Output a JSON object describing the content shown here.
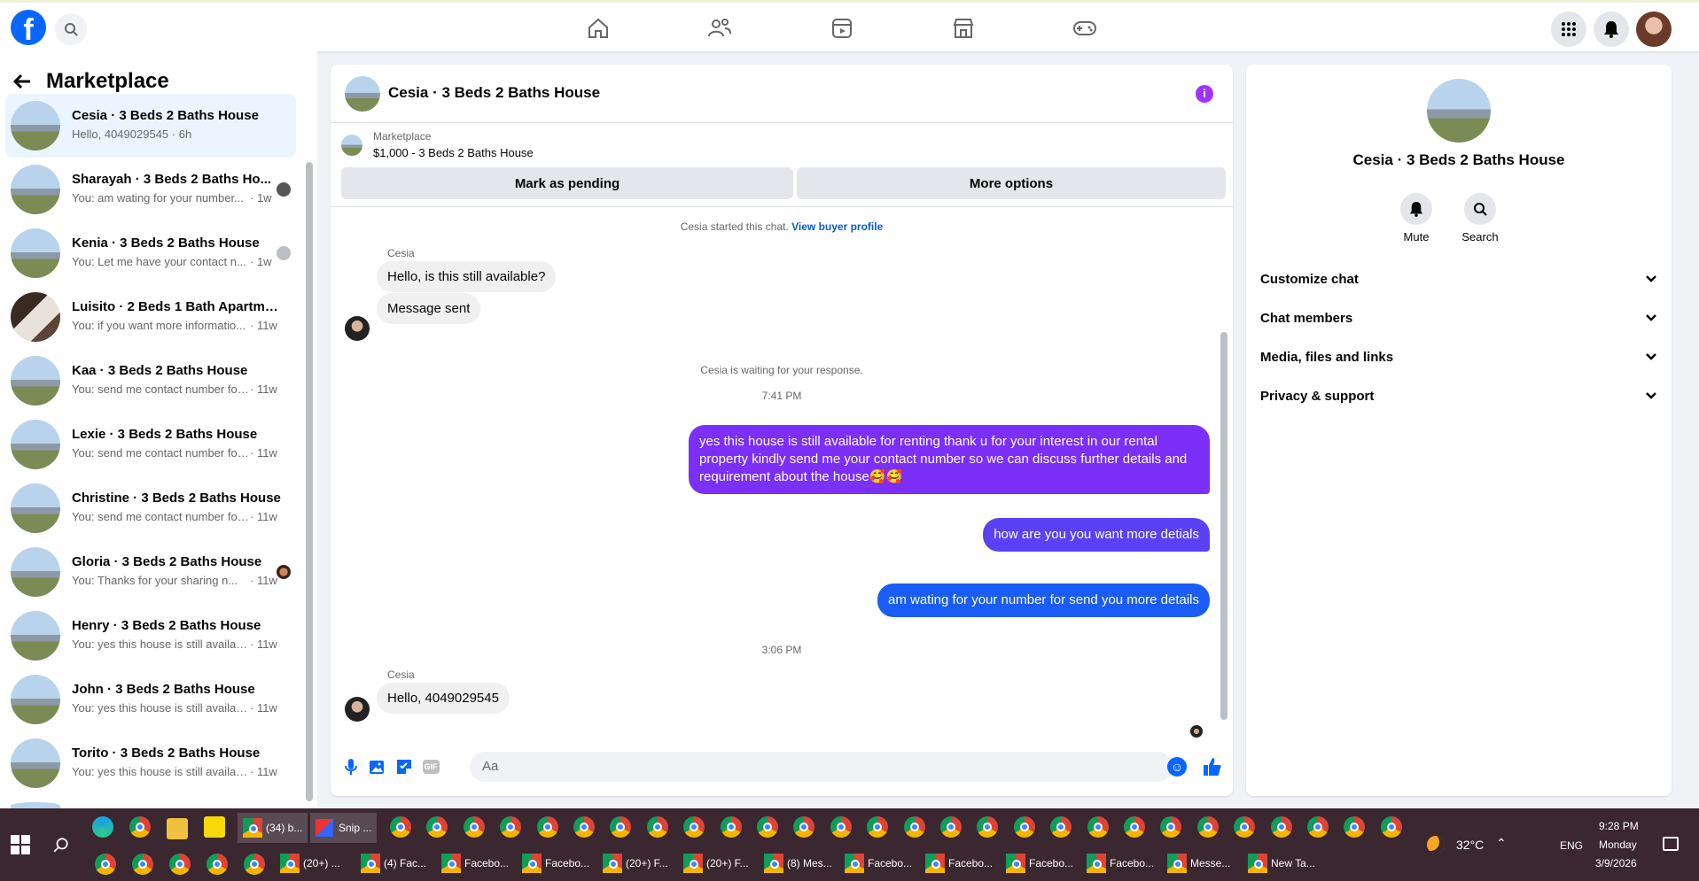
{
  "nav": {
    "logo_letter": "f"
  },
  "sidebar": {
    "title": "Marketplace",
    "conversations": [
      {
        "name": "Cesia · 3 Beds 2 Baths House",
        "preview": "Hello, 4049029545",
        "time": " · 6h",
        "active": true
      },
      {
        "name": "Sharayah · 3 Beds 2 Baths Ho...",
        "preview": "You: am wating for your number...",
        "time": " · 1w"
      },
      {
        "name": "Kenia · 3 Beds 2 Baths House",
        "preview": "You: Let me have your contact n...",
        "time": " · 1w"
      },
      {
        "name": "Luisito · 2 Beds 1 Bath Apartmen...",
        "preview": "You: if you want more informatio...",
        "time": " · 11w"
      },
      {
        "name": "Kaa · 3 Beds 2 Baths House",
        "preview": "You: send me contact number for ...",
        "time": " · 11w"
      },
      {
        "name": "Lexie · 3 Beds 2 Baths House",
        "preview": "You: send me contact number for ...",
        "time": " · 11w"
      },
      {
        "name": "Christine · 3 Beds 2 Baths House",
        "preview": "You: send me contact number for ...",
        "time": " · 11w"
      },
      {
        "name": "Gloria · 3 Beds 2 Baths House",
        "preview": "You: Thanks for your sharing n...",
        "time": " · 11w"
      },
      {
        "name": "Henry · 3 Beds 2 Baths House",
        "preview": "You: yes this house is still availabl...",
        "time": " · 11w"
      },
      {
        "name": "John · 3 Beds 2 Baths House",
        "preview": "You: yes this house is still availabl...",
        "time": " · 11w"
      },
      {
        "name": "Torito · 3 Beds 2 Baths House",
        "preview": "You: yes this house is still availabl...",
        "time": " · 11w"
      }
    ]
  },
  "chat": {
    "title": "Cesia · 3 Beds 2 Baths House",
    "info_glyph": "i",
    "marketplace_label": "Marketplace",
    "listing": "$1,000 - 3 Beds 2 Baths House",
    "mark_pending": "Mark as pending",
    "more_options": "More options",
    "started_text": "Cesia started this chat.",
    "view_profile": "View buyer profile",
    "sender_name": "Cesia",
    "msg_in_1": "Hello, is this still available?",
    "msg_in_2": "Message sent",
    "waiting_text": "Cesia is waiting for your response.",
    "time_1": "7:41 PM",
    "msg_out_1": "yes this house is still  available for renting thank u for your interest  in our rental property kindly send me your contact number so we can discuss further details and requirement about the house🥰🥰",
    "msg_out_2": "how are you  you want more detials",
    "msg_out_3": "am wating for your  number for send you more details",
    "time_2": "3:06 PM",
    "msg_in_3": "Hello, 4049029545",
    "composer_placeholder": "Aa",
    "gif_label": "GIF",
    "colors": {
      "out_purple": "#7b2ff7",
      "out_blue": "#1b5cf5"
    }
  },
  "rpanel": {
    "name": "Cesia · 3 Beds 2 Baths House",
    "mute": "Mute",
    "search": "Search",
    "rows": [
      "Customize chat",
      "Chat members",
      "Media, files and links",
      "Privacy & support"
    ]
  },
  "taskbar": {
    "snip_label": "Snip ...",
    "active_tab": "(34) b...",
    "tabs": [
      "(20+) ...",
      "(4) Fac...",
      "Facebo...",
      "Facebo...",
      "(20+) F...",
      "(20+) F...",
      "(8) Mes...",
      "Facebo...",
      "Facebo...",
      "Facebo...",
      "Facebo...",
      "Messe...",
      "New Ta..."
    ],
    "weather": "32°C",
    "lang": "ENG",
    "time": "9:28 PM",
    "day": "Monday",
    "date": "3/9/2026"
  }
}
